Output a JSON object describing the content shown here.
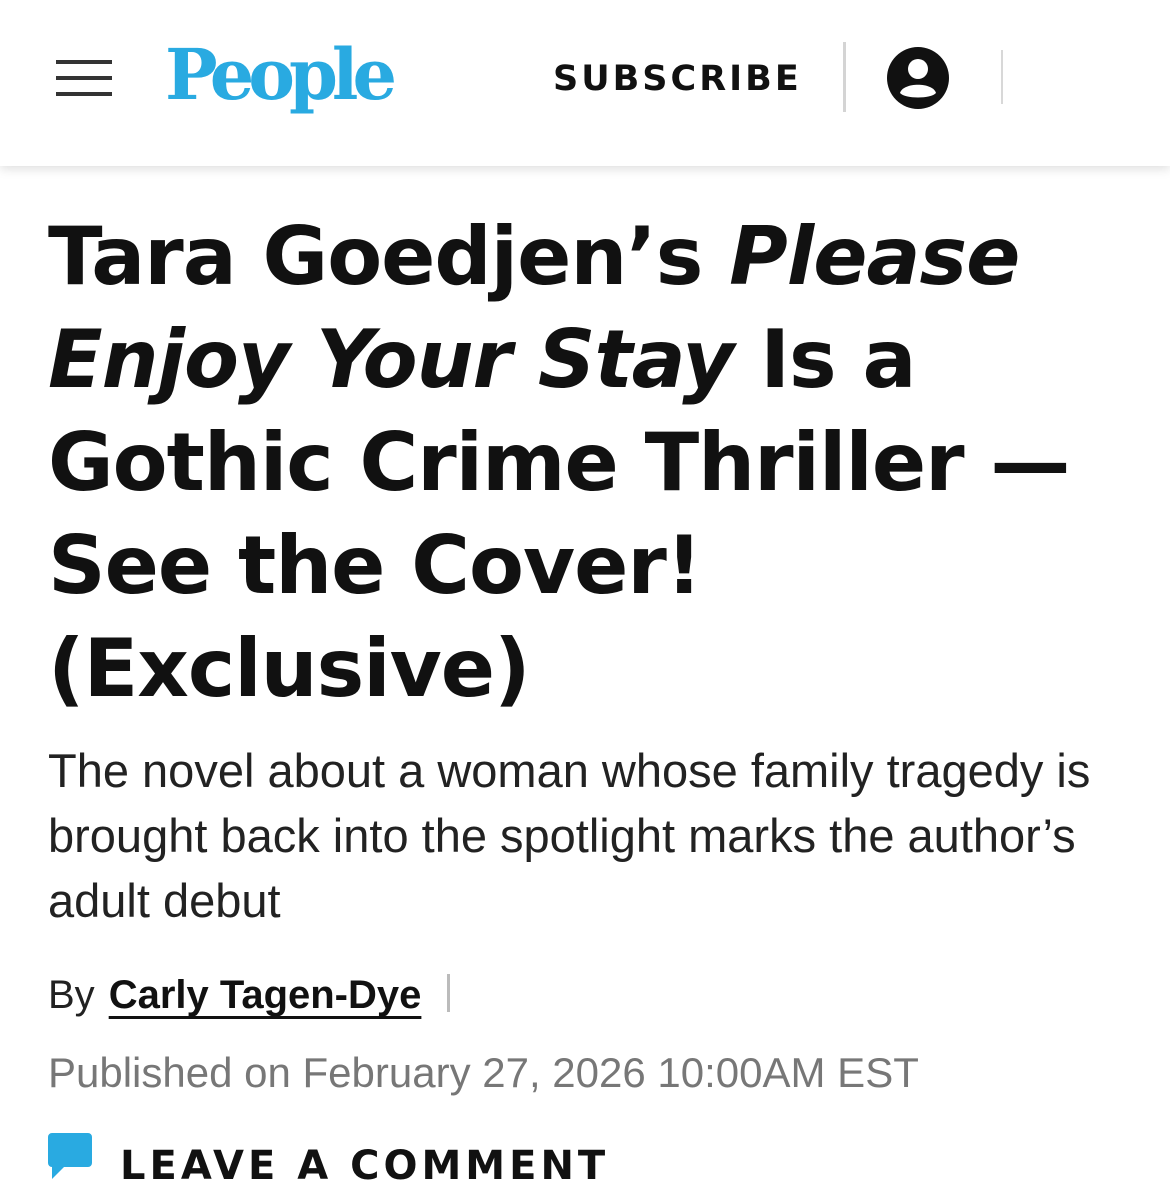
{
  "header": {
    "logo_text": "People",
    "subscribe_label": "SUBSCRIBE",
    "menu_icon": "hamburger-menu-icon",
    "account_icon": "user-account-icon",
    "logo_color": "#29aae1"
  },
  "article": {
    "headline": {
      "part1": "Tara Goedjen’s ",
      "title_italic": "Please Enjoy Your Stay",
      "part2": " Is a Gothic Crime Thriller — See the Cover! (Exclusive)"
    },
    "dek": "The novel about a woman whose family tragedy is brought back into the spotlight marks the author’s adult debut",
    "byline": {
      "prefix": "By",
      "author": "Carly Tagen-Dye"
    },
    "published": "Published on February 27, 2026 10:00AM EST",
    "comment": {
      "label": "LEAVE A COMMENT",
      "icon": "comment-bubble-icon",
      "icon_color": "#29aae1"
    }
  }
}
